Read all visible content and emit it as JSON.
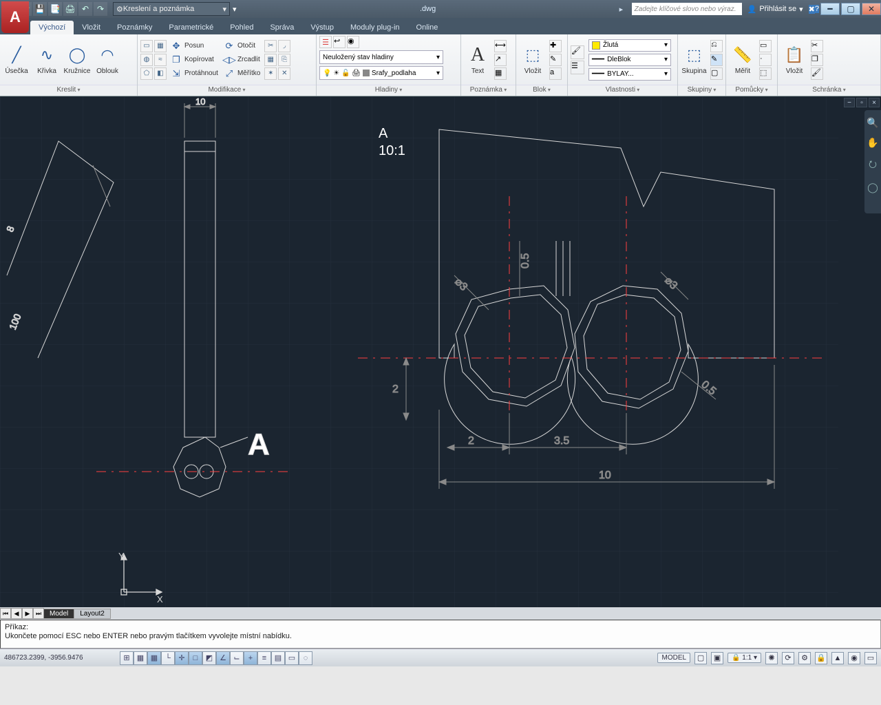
{
  "title": {
    "filename": ".dwg",
    "workspace": "Kreslení a poznámka",
    "search_placeholder": "Zadejte klíčové slovo nebo výraz.",
    "signin": "Přihlásit se"
  },
  "tabs": {
    "t0": "Výchozí",
    "t1": "Vložit",
    "t2": "Poznámky",
    "t3": "Parametrické",
    "t4": "Pohled",
    "t5": "Správa",
    "t6": "Výstup",
    "t7": "Moduly plug-in",
    "t8": "Online"
  },
  "panels": {
    "draw": {
      "title": "Kreslit",
      "line": "Úsečka",
      "pline": "Křivka",
      "circle": "Kružnice",
      "arc": "Oblouk"
    },
    "modify": {
      "title": "Modifikace",
      "move": "Posun",
      "rotate": "Otočit",
      "copy": "Kopírovat",
      "mirror": "Zrcadlit",
      "stretch": "Protáhnout",
      "scale": "Měřítko"
    },
    "layers": {
      "title": "Hladiny",
      "state": "Neuložený stav hladiny",
      "current": "Srafy_podlaha"
    },
    "annot": {
      "title": "Poznámka",
      "text": "Text"
    },
    "block": {
      "title": "Blok",
      "insert": "Vložit"
    },
    "props": {
      "title": "Vlastnosti",
      "color": "Žlutá",
      "ltype": "DleBlok",
      "lweight": "BYLAY..."
    },
    "groups": {
      "title": "Skupiny",
      "group": "Skupina"
    },
    "utils": {
      "title": "Pomůcky",
      "measure": "Měřit"
    },
    "clip": {
      "title": "Schránka",
      "paste": "Vložit"
    }
  },
  "drawing": {
    "detail_label": "A",
    "detail_scale": "10:1",
    "dim_10": "10",
    "dim_100": "100",
    "dim_8": "8",
    "dim_2": "2",
    "dim_3_5": "3.5",
    "dim_10b": "10",
    "dim_v2": "2",
    "dim_0_5": "0.5",
    "dia3a": "⌀3",
    "dia3b": "⌀3",
    "dim_0_5b": "0.5",
    "callout": "A",
    "axis_x": "X",
    "axis_y": "Y"
  },
  "model_tabs": {
    "model": "Model",
    "layout": "Layout2"
  },
  "command": {
    "prompt": "Příkaz:",
    "line2": "Ukončete pomocí ESC nebo ENTER nebo pravým tlačítkem vyvolejte místní nabídku."
  },
  "status": {
    "coords": "486723.2399, -3956.9476",
    "model": "MODEL",
    "scale": "1:1"
  }
}
